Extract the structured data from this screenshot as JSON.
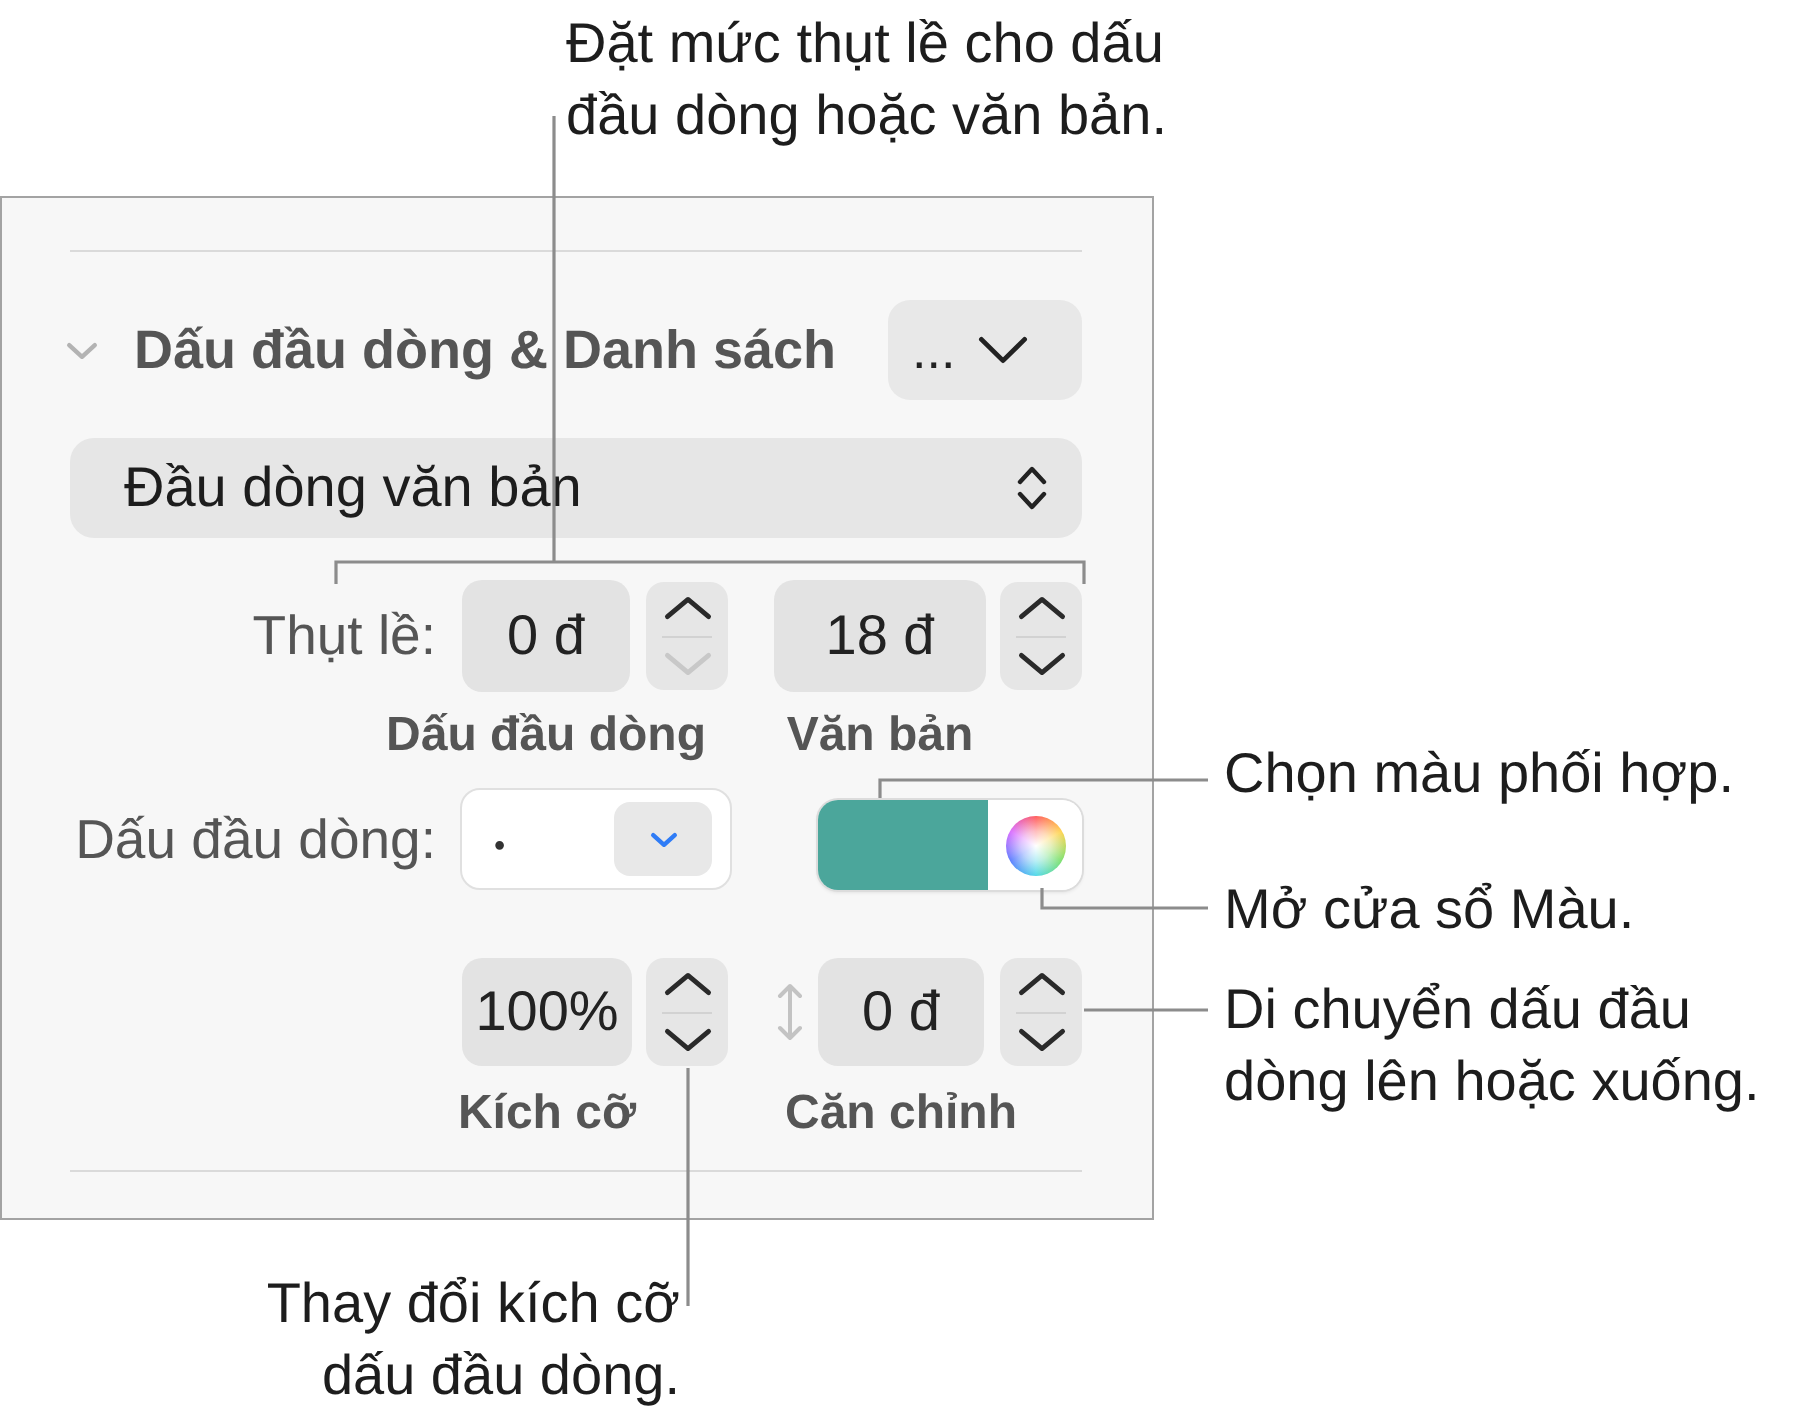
{
  "panel": {
    "section": {
      "title": "Dấu đầu dòng & Danh sách",
      "expanded": true,
      "menu_label": "..."
    },
    "list_style": {
      "value": "Đầu dòng văn bản"
    },
    "indent": {
      "label": "Thụt lề:",
      "steppers": [
        {
          "value": "0 đ",
          "caption": "Dấu đầu dòng",
          "down_disabled": true
        },
        {
          "value": "18 đ",
          "caption": "Văn bản",
          "down_disabled": false
        }
      ]
    },
    "bullet": {
      "label": "Dấu đầu dòng:",
      "value": "•",
      "color": "#4ba69b"
    },
    "size": {
      "steppers": [
        {
          "kind": "size",
          "value": "100%",
          "caption": "Kích cỡ",
          "down_disabled": false
        },
        {
          "kind": "alignment",
          "value": "0 đ",
          "caption": "Căn chỉnh",
          "down_disabled": false
        }
      ]
    }
  },
  "callouts": [
    {
      "lines": [
        "Đặt mức thụt lề cho dấu",
        "đầu dòng hoặc văn bản."
      ]
    },
    {
      "lines": [
        "Chọn màu phối hợp."
      ]
    },
    {
      "lines": [
        "Mở cửa sổ Màu."
      ]
    },
    {
      "lines": [
        "Di chuyển dấu đầu",
        "dòng lên hoặc xuống."
      ]
    },
    {
      "lines": [
        "Thay đổi kích cỡ",
        "dấu đầu dòng."
      ]
    }
  ]
}
